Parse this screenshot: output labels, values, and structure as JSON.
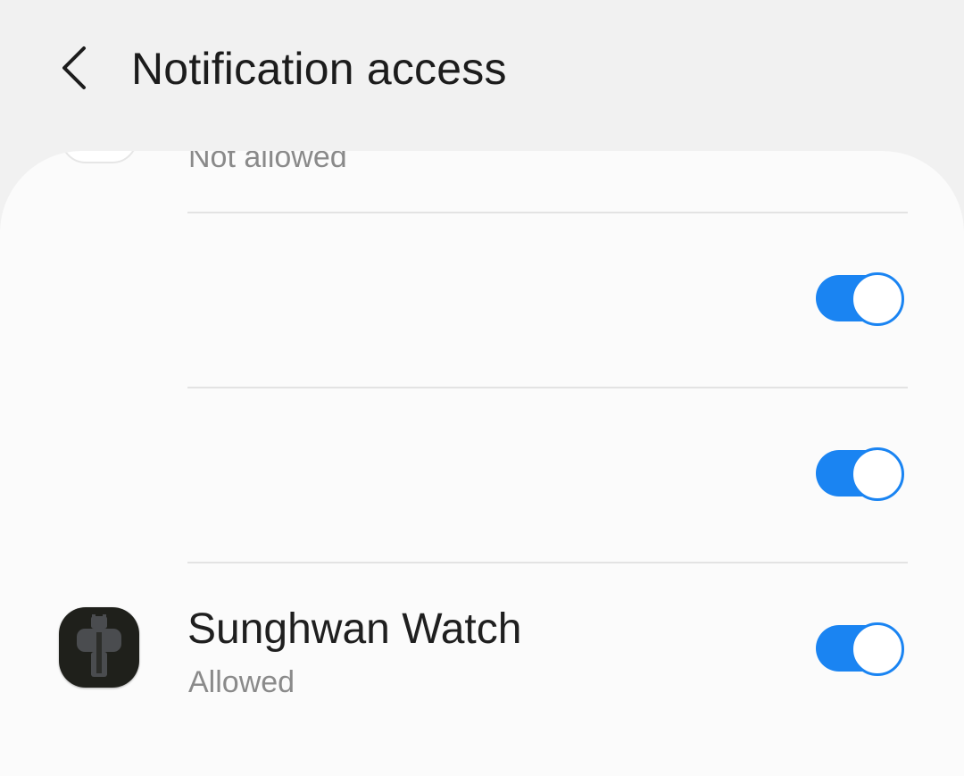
{
  "header": {
    "title": "Notification access",
    "back_icon": "chevron-left-icon"
  },
  "apps": [
    {
      "name": "",
      "status": "Not allowed",
      "icon": "app-icon",
      "toggle_on": null
    },
    {
      "name": "",
      "status": "",
      "icon": "",
      "toggle_on": true
    },
    {
      "name": "",
      "status": "",
      "icon": "",
      "toggle_on": true
    },
    {
      "name": "Sunghwan Watch",
      "status": "Allowed",
      "icon": "watch-icon",
      "toggle_on": true
    }
  ],
  "colors": {
    "accent": "#1a84f2",
    "background": "#f1f1f1",
    "card": "#fbfbfb",
    "divider": "#e3e3e3",
    "primary_text": "#1f1f1f",
    "secondary_text": "#8a8a8a"
  }
}
